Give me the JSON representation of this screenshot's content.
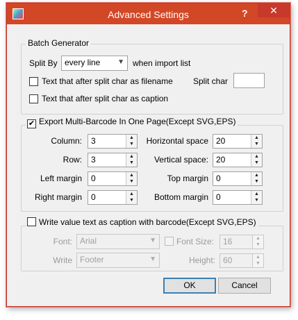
{
  "window": {
    "title": "Advanced Settings",
    "help": "?",
    "close": "✕"
  },
  "batch": {
    "legend": "Batch Generator",
    "split_by_label": "Split By",
    "split_by_value": "every line",
    "when_import_label": "when import list",
    "filename_label": "Text that after split char as filename",
    "filename_checked": false,
    "split_char_label": "Split char",
    "split_char_value": "",
    "caption_label": "Text that after split char as caption",
    "caption_checked": false
  },
  "export": {
    "legend": "Export Multi-Barcode In One Page(Except SVG,EPS)",
    "checked": true,
    "column_label": "Column:",
    "column_value": "3",
    "hspace_label": "Horizontal space",
    "hspace_value": "20",
    "row_label": "Row:",
    "row_value": "3",
    "vspace_label": "Vertical space:",
    "vspace_value": "20",
    "left_label": "Left margin",
    "left_value": "0",
    "top_label": "Top margin",
    "top_value": "0",
    "right_label": "Right margin",
    "right_value": "0",
    "bottom_label": "Bottom margin",
    "bottom_value": "0"
  },
  "caption": {
    "legend": "Write value text as caption with barcode(Except SVG,EPS)",
    "checked": false,
    "font_label": "Font:",
    "font_value": "Arial",
    "font_size_label": "Font Size:",
    "font_size_value": "16",
    "write_label": "Write",
    "write_value": "Footer",
    "height_label": "Height:",
    "height_value": "60"
  },
  "buttons": {
    "ok": "OK",
    "cancel": "Cancel"
  }
}
